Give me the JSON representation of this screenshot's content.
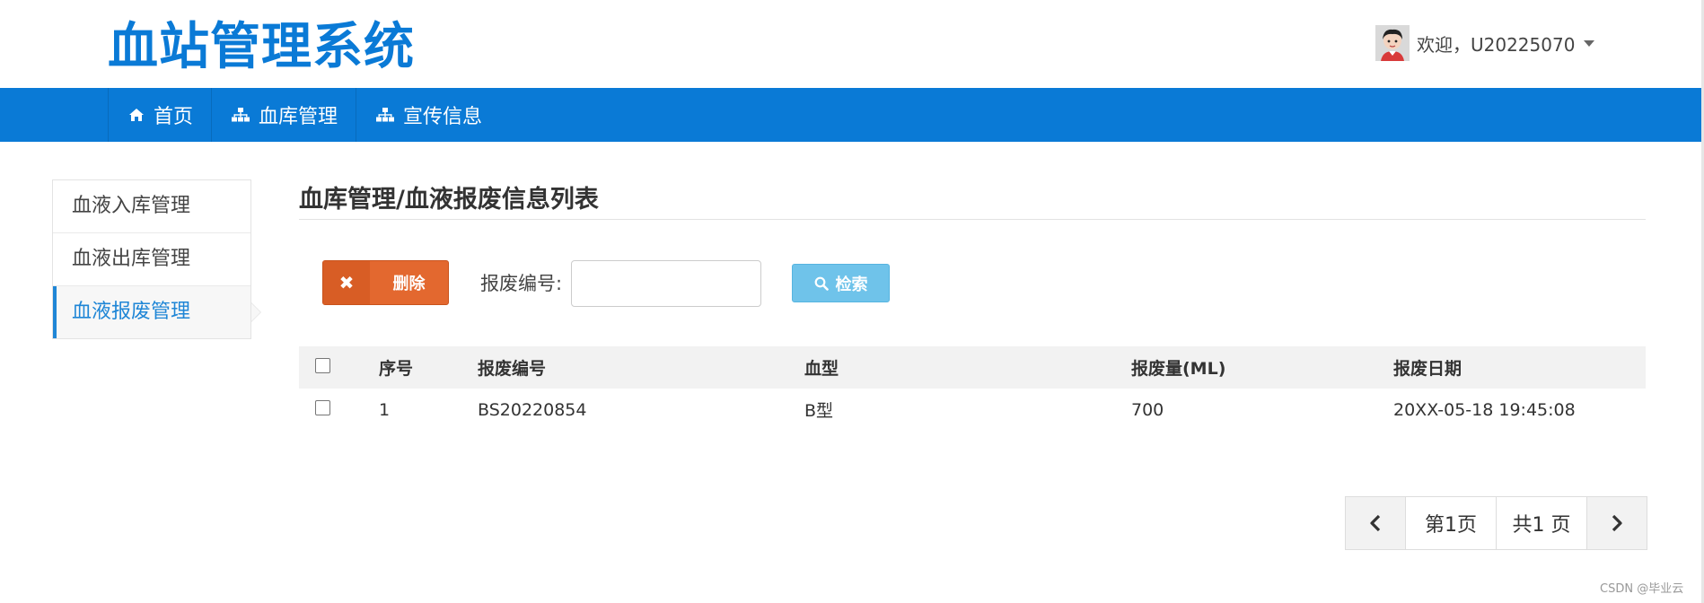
{
  "header": {
    "brand": "血站管理系统",
    "user_greeting": "欢迎，U20225070",
    "avatar_icon": "user-avatar-icon",
    "dropdown_icon": "caret-down-icon"
  },
  "nav": {
    "items": [
      {
        "label": "首页",
        "icon": "home-icon"
      },
      {
        "label": "血库管理",
        "icon": "sitemap-icon"
      },
      {
        "label": "宣传信息",
        "icon": "sitemap-icon"
      }
    ]
  },
  "sidebar": {
    "items": [
      {
        "label": "血液入库管理",
        "active": false
      },
      {
        "label": "血液出库管理",
        "active": false
      },
      {
        "label": "血液报废管理",
        "active": true
      }
    ]
  },
  "main": {
    "title": "血库管理/血液报废信息列表",
    "delete_label": "删除",
    "search_label": "报废编号:",
    "search_value": "",
    "search_button": "检索"
  },
  "table": {
    "headers": [
      "序号",
      "报废编号",
      "血型",
      "报废量(ML)",
      "报废日期"
    ],
    "rows": [
      [
        "1",
        "BS20220854",
        "B型",
        "700",
        "20XX-05-18 19:45:08"
      ]
    ]
  },
  "pagination": {
    "current": "第1页",
    "total": "共1 页"
  },
  "watermark": "CSDN @毕业云",
  "colors": {
    "brand": "#0a7ad6",
    "delete": "#e3682f",
    "search": "#6fc3ea",
    "active_side": "#1f86d6"
  }
}
